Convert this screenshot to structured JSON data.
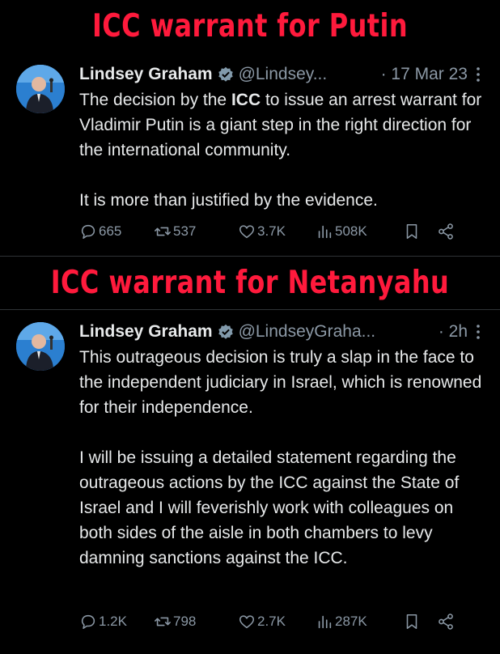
{
  "headlines": {
    "first": "ICC warrant for Putin",
    "second": "ICC warrant for Netanyahu"
  },
  "tweets": [
    {
      "name": "Lindsey Graham",
      "handle": "@Lindsey...",
      "date": "· 17 Mar 23",
      "text_pre": "The decision by the ",
      "text_bold": "ICC",
      "text_post": " to issue an arrest warrant for Vladimir Putin is a giant step in the right direction for the international community.",
      "paragraph2": "It is more than justified by the evidence.",
      "replies": "665",
      "reposts": "537",
      "likes": "3.7K",
      "views": "508K"
    },
    {
      "name": "Lindsey Graham",
      "handle": "@LindseyGraha...",
      "date": "· 2h",
      "paragraph1": "This outrageous decision is truly a slap in the face to the independent judiciary in Israel, which is renowned for their independence.",
      "paragraph2": "I will be issuing a detailed statement regarding the outrageous actions by the ICC against the State of Israel and I will feverishly work with colleagues on both sides of the aisle in both chambers to levy damning sanctions against the ICC.",
      "replies": "1.2K",
      "reposts": "798",
      "likes": "2.7K",
      "views": "287K"
    }
  ],
  "icons": [
    "avatar",
    "verified-badge-icon",
    "more-icon",
    "reply-icon",
    "repost-icon",
    "like-icon",
    "views-icon",
    "bookmark-icon",
    "share-icon"
  ],
  "colors": {
    "headline": "#ff1a3c",
    "background": "#000000",
    "muted": "#8b98a5",
    "verified": "#829aab"
  }
}
